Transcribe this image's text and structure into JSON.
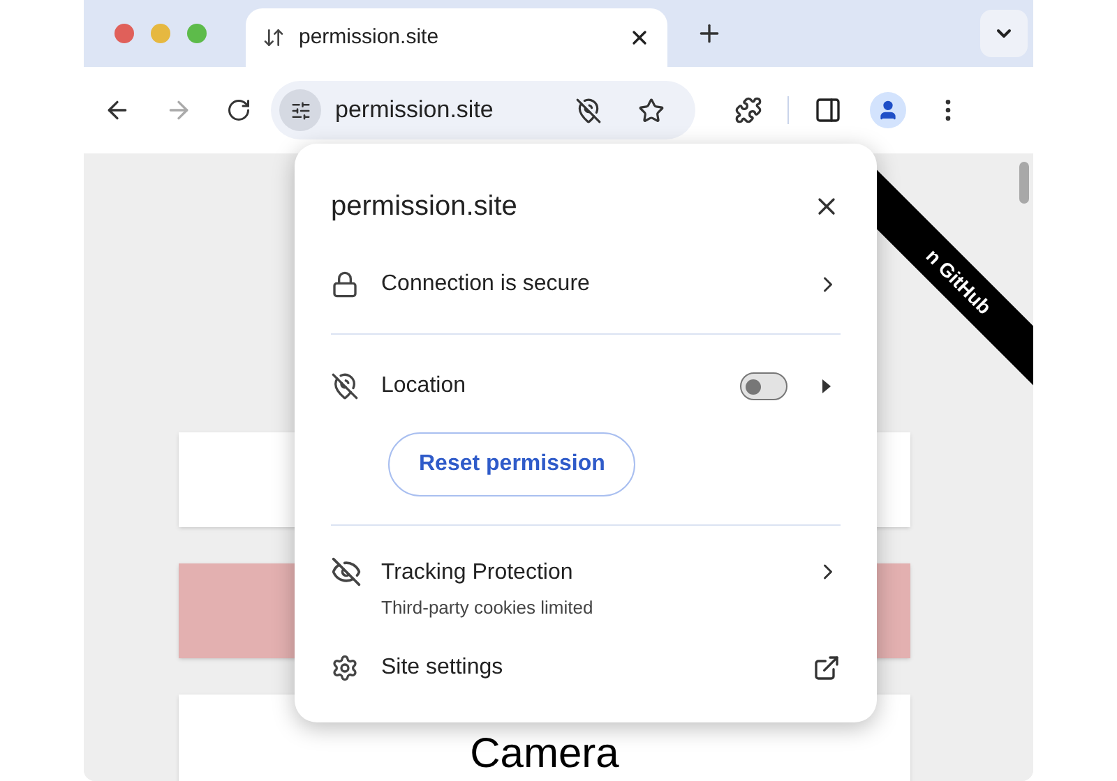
{
  "tab": {
    "title": "permission.site",
    "selected": true
  },
  "address_bar": {
    "url": "permission.site"
  },
  "page": {
    "ribbon": {
      "text": "n GitHub"
    },
    "cards": [
      {
        "color": "#ffffff"
      },
      {
        "color": "#e3b0b0"
      },
      {
        "color": "#ffffff",
        "text": "Camera"
      }
    ]
  },
  "popup": {
    "title": "permission.site",
    "connection": {
      "label": "Connection is secure"
    },
    "permission": {
      "label": "Location",
      "on": false,
      "reset_button": "Reset permission"
    },
    "tracking": {
      "label": "Tracking Protection",
      "detail": "Third-party cookies limited"
    },
    "site_settings": {
      "label": "Site settings"
    }
  }
}
